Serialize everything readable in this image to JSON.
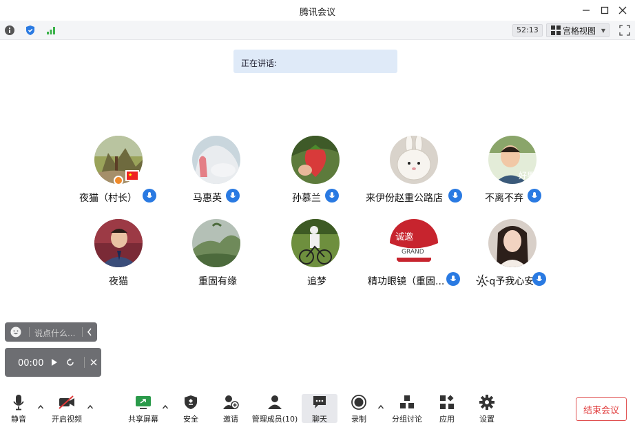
{
  "window": {
    "title": "腾讯会议"
  },
  "infobar": {
    "timer": "52:13",
    "view_label": "宫格视图",
    "icons": [
      "info-icon",
      "shield-icon",
      "signal-icon",
      "fullscreen-icon"
    ]
  },
  "speaking": {
    "label": "正在讲话:"
  },
  "participants": [
    {
      "name": "夜猫（村长）",
      "badge": "mic"
    },
    {
      "name": "马惠英",
      "badge": "mic"
    },
    {
      "name": "孙慕兰",
      "badge": "mic"
    },
    {
      "name": "来伊份赵重公路店",
      "badge": "mic"
    },
    {
      "name": "不离不弃",
      "badge": "mic"
    },
    {
      "name": "夜猫",
      "badge": ""
    },
    {
      "name": "重固有缘",
      "badge": ""
    },
    {
      "name": "追梦",
      "badge": ""
    },
    {
      "name": "精功眼镜（重固...",
      "badge": "mic"
    },
    {
      "name": "A҉q予我心安",
      "badge": "mic"
    }
  ],
  "chat": {
    "placeholder": "说点什么..."
  },
  "player": {
    "time": "00:00"
  },
  "toolbar": {
    "mute": "静音",
    "video": "开启视频",
    "share": "共享屏幕",
    "security": "安全",
    "invite": "邀请",
    "members": "管理成员(10)",
    "chat": "聊天",
    "record": "录制",
    "breakout": "分组讨论",
    "apps": "应用",
    "settings": "设置",
    "end": "结束会议"
  },
  "colors": {
    "accent": "#2a7ae2",
    "end": "#e03a3a",
    "banner": "#dfeaf8"
  }
}
